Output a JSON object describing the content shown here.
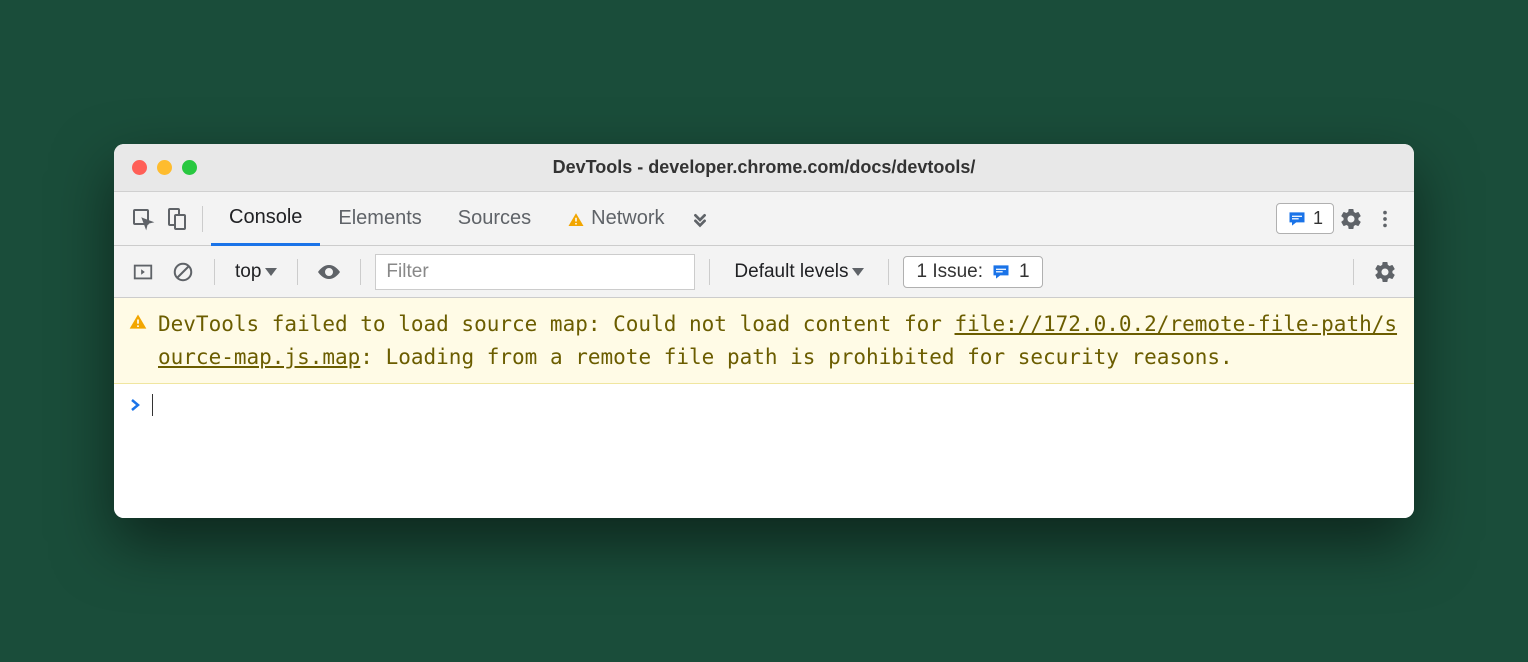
{
  "window": {
    "title": "DevTools - developer.chrome.com/docs/devtools/"
  },
  "tabs": {
    "console": "Console",
    "elements": "Elements",
    "sources": "Sources",
    "network": "Network"
  },
  "badges": {
    "messages_count": "1",
    "issues_label": "1 Issue:",
    "issues_count": "1"
  },
  "toolbar": {
    "context": "top",
    "filter_placeholder": "Filter",
    "levels": "Default levels"
  },
  "console": {
    "warning_prefix": "DevTools failed to load source map: Could not load content for ",
    "warning_link": "file://172.0.0.2/remote-file-path/source-map.js.map",
    "warning_suffix": ": Loading from a remote file path is prohibited for security reasons."
  }
}
